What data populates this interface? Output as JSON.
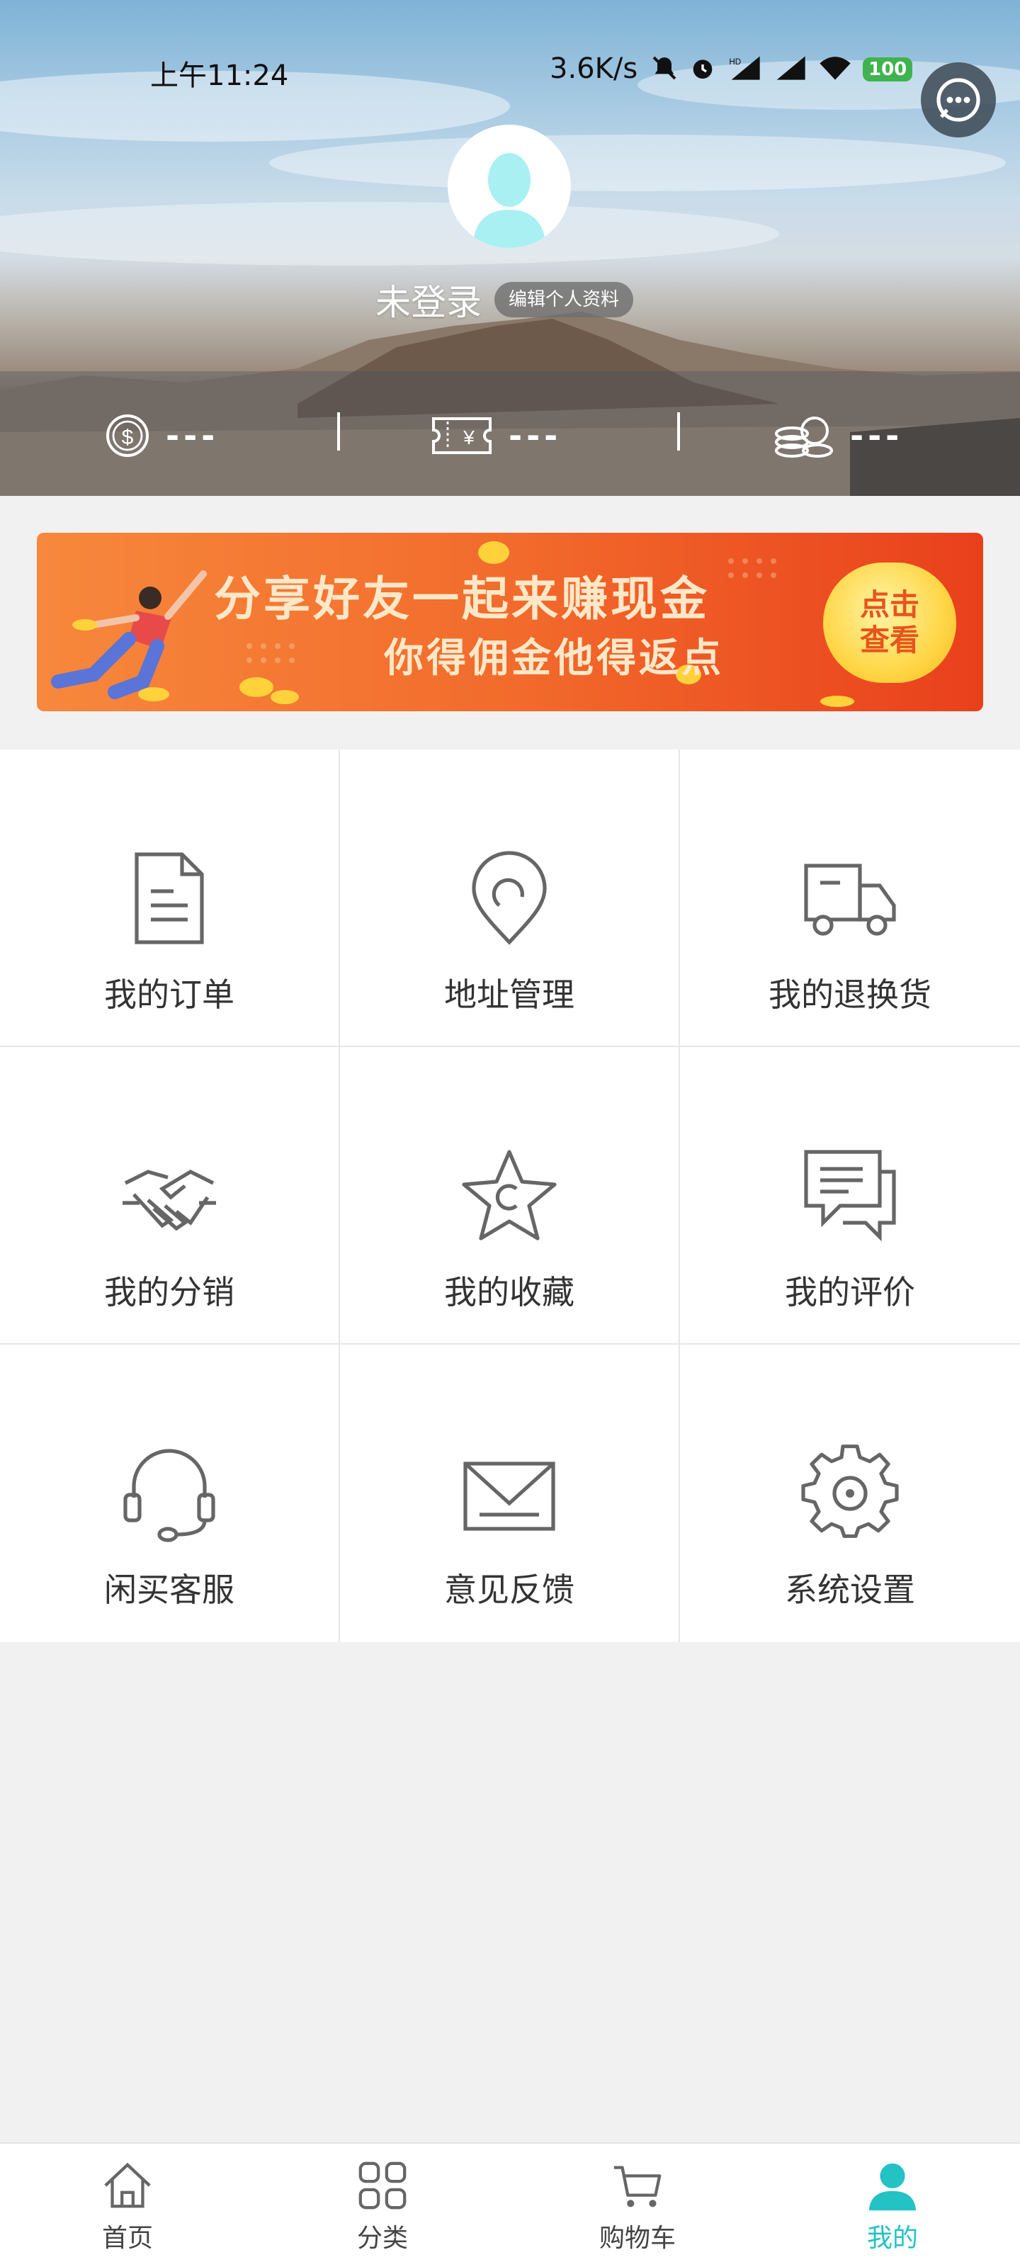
{
  "status_bar": {
    "time": "上午11:24",
    "speed": "3.6K/s",
    "network": "HD",
    "battery": "100"
  },
  "profile": {
    "login_status": "未登录",
    "edit_label": "编辑个人资料"
  },
  "stats": [
    {
      "icon": "dollar-coin-icon",
      "value": "---"
    },
    {
      "icon": "coupon-icon",
      "value": "---"
    },
    {
      "icon": "coins-stack-icon",
      "value": "---"
    }
  ],
  "banner": {
    "line1": "分享好友一起来赚现金",
    "line2": "你得佣金他得返点",
    "cta_line1": "点击",
    "cta_line2": "查看"
  },
  "menu": [
    {
      "label": "我的订单",
      "icon": "order-document-icon"
    },
    {
      "label": "地址管理",
      "icon": "location-pin-icon"
    },
    {
      "label": "我的退换货",
      "icon": "delivery-truck-icon"
    },
    {
      "label": "我的分销",
      "icon": "handshake-icon"
    },
    {
      "label": "我的收藏",
      "icon": "star-icon"
    },
    {
      "label": "我的评价",
      "icon": "comment-icon"
    },
    {
      "label": "闲买客服",
      "icon": "headset-icon"
    },
    {
      "label": "意见反馈",
      "icon": "envelope-icon"
    },
    {
      "label": "系统设置",
      "icon": "gear-icon"
    }
  ],
  "tabs": [
    {
      "label": "首页",
      "icon": "home-icon"
    },
    {
      "label": "分类",
      "icon": "grid-icon"
    },
    {
      "label": "购物车",
      "icon": "cart-icon"
    },
    {
      "label": "我的",
      "icon": "user-icon",
      "active": true
    }
  ],
  "colors": {
    "accent": "#23c2c5",
    "banner_start": "#f7883c",
    "banner_end": "#e9401c",
    "icon_gray": "#666666"
  }
}
